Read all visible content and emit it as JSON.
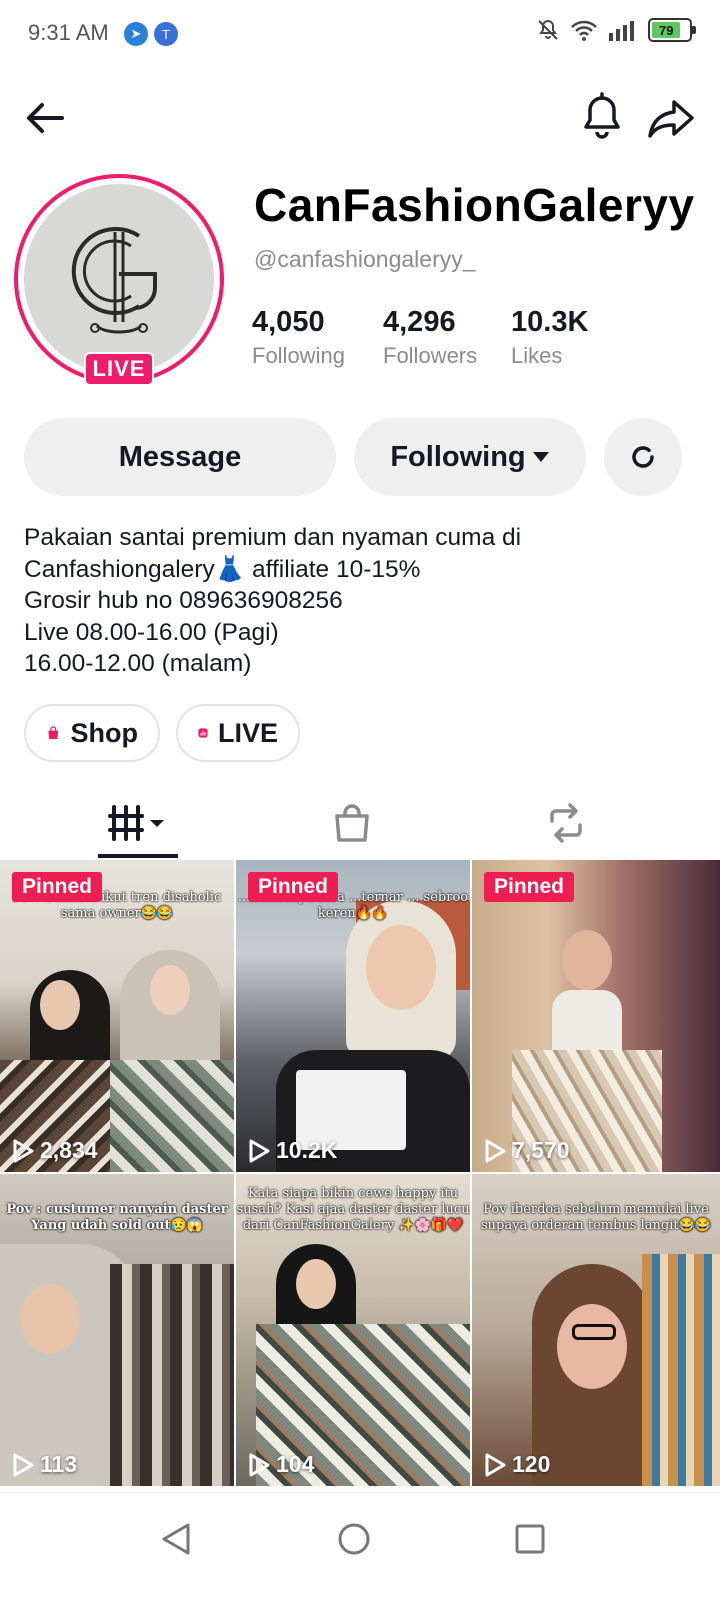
{
  "status_bar": {
    "time": "9:31 AM",
    "battery": "79",
    "battery_level": 0.79
  },
  "profile": {
    "display_name": "CanFashionGaleryy",
    "username": "@canfashiongaleryy_",
    "live_badge": "LIVE",
    "stats": [
      {
        "value": "4,050",
        "label": "Following"
      },
      {
        "value": "4,296",
        "label": "Followers"
      },
      {
        "value": "10.3K",
        "label": "Likes"
      }
    ]
  },
  "actions": {
    "message_label": "Message",
    "following_label": "Following"
  },
  "bio": {
    "lines": [
      "Pakaian santai premium dan nyaman cuma di",
      "Canfashiongalery👗 affiliate 10-15%",
      "Grosir hub no 089636908256",
      "Live 08.00-16.00 (Pagi)",
      "16.00-12.00 (malam)"
    ]
  },
  "links": {
    "shop_label": "Shop",
    "live_label": "LIVE"
  },
  "tabs": [
    "videos-icon",
    "shop-bag-icon",
    "repost-icon"
  ],
  "videos": [
    {
      "pinned": "Pinned",
      "views": "2,834",
      "caption": "Pov: Diminta ikut tren disaholic sama owner😂😂"
    },
    {
      "pinned": "Pinned",
      "views": "10.2K",
      "caption": "...nokhenya bisa ...ternar ... sebroo keren🔥🔥"
    },
    {
      "pinned": "Pinned",
      "views": "7,570",
      "caption": ""
    },
    {
      "pinned": "",
      "views": "113",
      "caption": "Pov : custumer nanyain daster Yang udah sold out😥😱"
    },
    {
      "pinned": "",
      "views": "104",
      "caption": "Kata siapa bikin cewe happy itu susah? Kasi ajaa daster daster lucu dari CanFashionGalery ✨🌸🎁❤️"
    },
    {
      "pinned": "",
      "views": "120",
      "caption": "Pov iberdoa sebelum memulai live supaya orderan tembus langit😂😂"
    }
  ],
  "colors": {
    "accent": "#ee1d52",
    "live_pink": "#ee1d6c",
    "text": "#161823",
    "muted": "#8a8b91"
  }
}
